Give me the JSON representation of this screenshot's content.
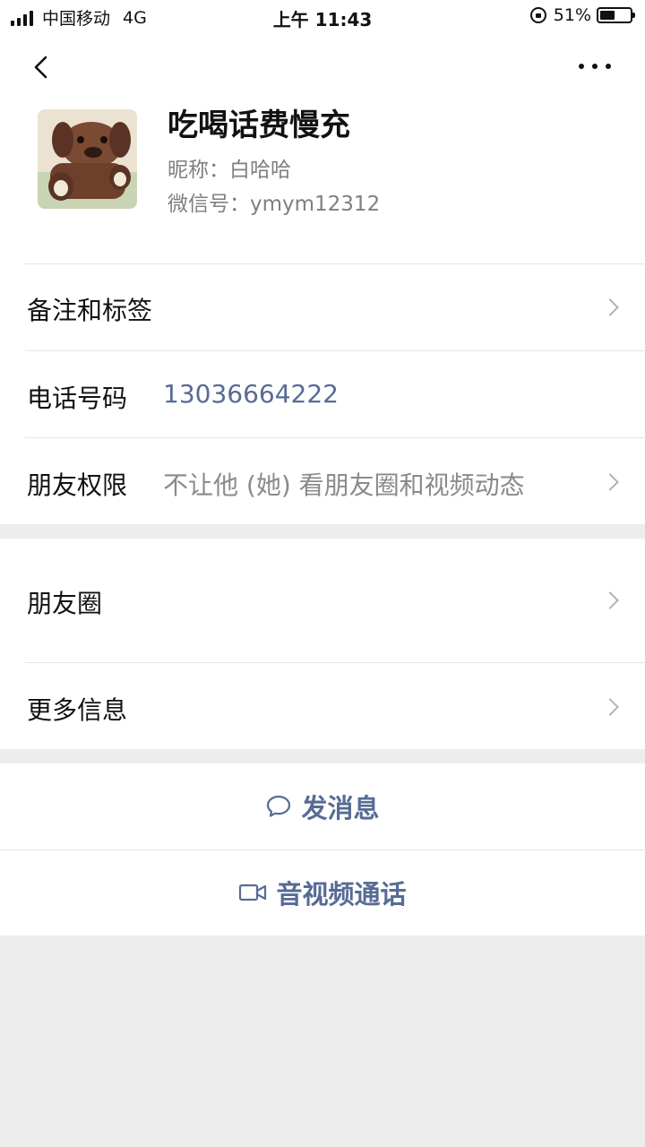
{
  "status_bar": {
    "carrier": "中国移动",
    "network": "4G",
    "time": "上午 11:43",
    "battery_percent": "51%",
    "battery_level": 0.51,
    "signal_icon": "signal-icon",
    "rotation_lock_icon": "rotation-lock-icon",
    "battery_icon": "battery-icon"
  },
  "nav": {
    "back_icon": "back-chevron-icon",
    "more_icon": "more-dots-icon"
  },
  "profile": {
    "name": "吃喝话费慢充",
    "nickname": "昵称：白哈哈",
    "wechat_id": "微信号：ymym12312",
    "avatar": "plush-dog-avatar"
  },
  "rows": {
    "remarks": {
      "label": "备注和标签"
    },
    "phone": {
      "label": "电话号码",
      "value": "13036664222"
    },
    "permissions": {
      "label": "朋友权限",
      "value": "不让他 (她) 看朋友圈和视频动态"
    },
    "moments": {
      "label": "朋友圈"
    },
    "more_info": {
      "label": "更多信息"
    }
  },
  "actions": {
    "message": {
      "label": "发消息",
      "icon": "chat-bubble-icon"
    },
    "call": {
      "label": "音视频通话",
      "icon": "video-camera-icon"
    }
  },
  "colors": {
    "link": "#576b95",
    "secondary_text": "#7f7f7f",
    "background": "#ededed"
  }
}
